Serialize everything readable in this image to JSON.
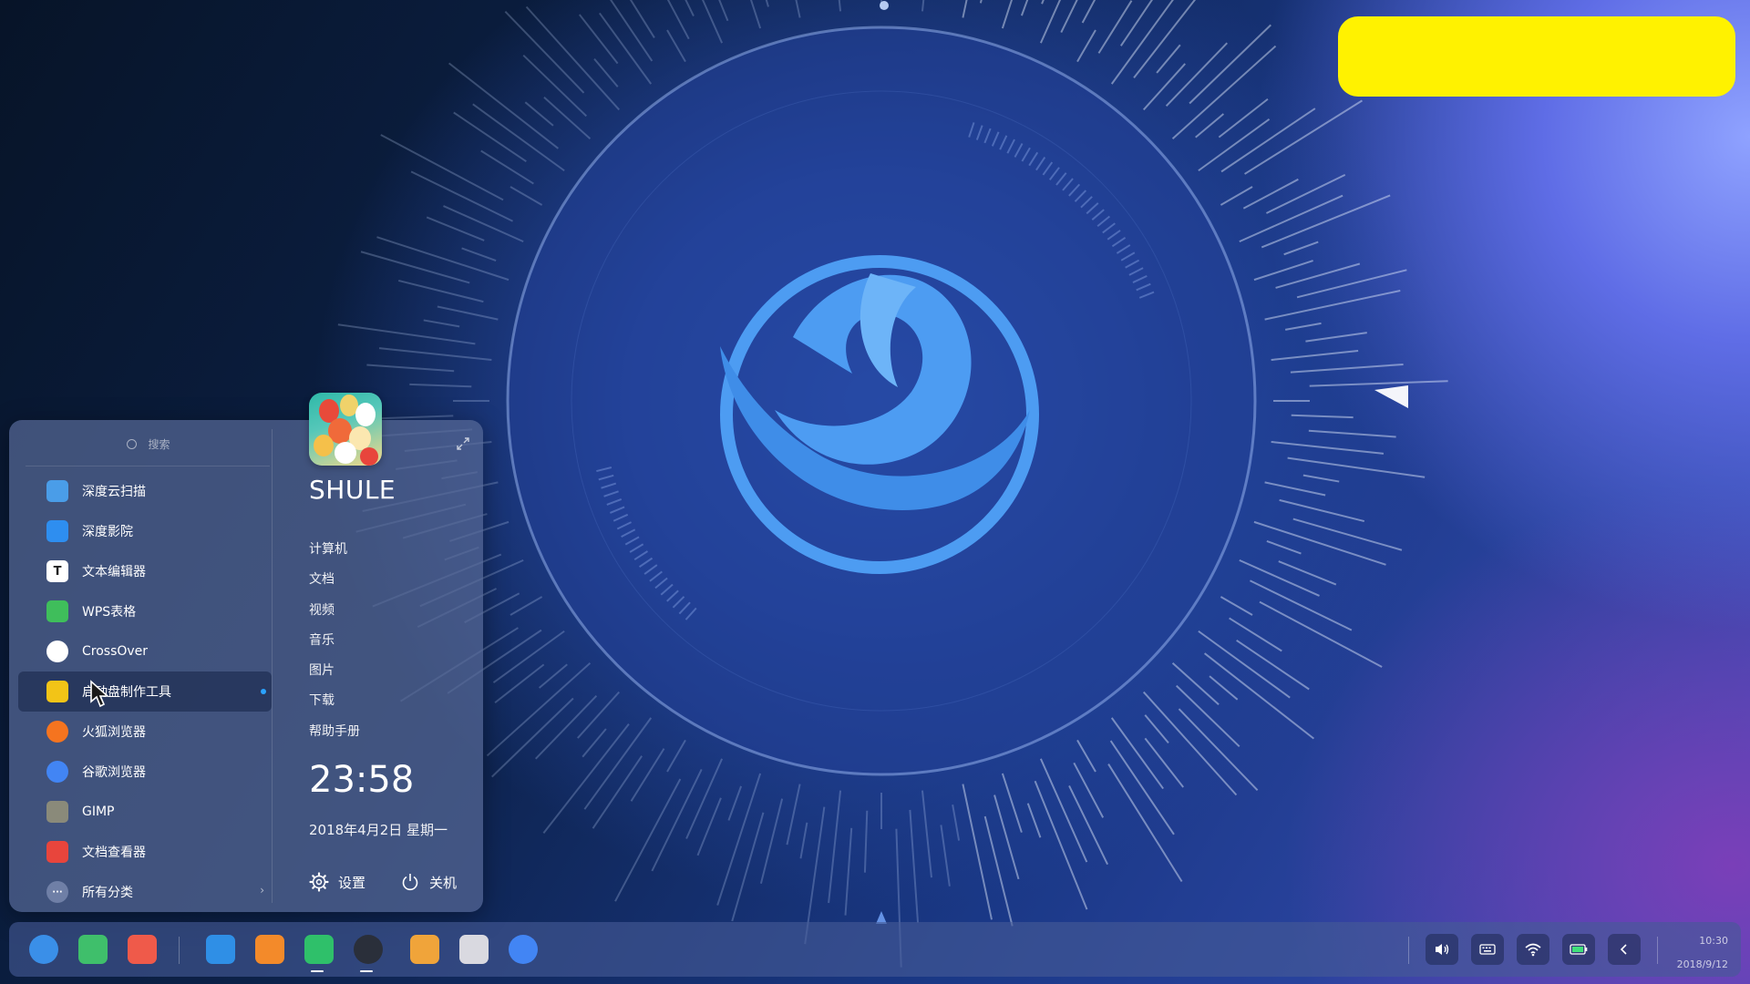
{
  "launcher": {
    "search_placeholder": "搜索",
    "apps": [
      {
        "label": "深度云扫描",
        "icon": "scanner-icon",
        "color": "#4a9de8"
      },
      {
        "label": "深度影院",
        "icon": "movie-icon",
        "color": "#2e8ef0"
      },
      {
        "label": "文本编辑器",
        "icon": "text-editor-icon",
        "color": "#ffffff"
      },
      {
        "label": "WPS表格",
        "icon": "spreadsheet-icon",
        "color": "#3fbe5b"
      },
      {
        "label": "CrossOver",
        "icon": "crossover-icon",
        "color": "#ffffff"
      },
      {
        "label": "启动盘制作工具",
        "icon": "bootmaker-icon",
        "color": "#f2c417"
      },
      {
        "label": "火狐浏览器",
        "icon": "firefox-icon",
        "color": "#f5741f"
      },
      {
        "label": "谷歌浏览器",
        "icon": "chrome-icon",
        "color": "#4285f4"
      },
      {
        "label": "GIMP",
        "icon": "gimp-icon",
        "color": "#8a8a7a"
      },
      {
        "label": "文档查看器",
        "icon": "document-viewer-icon",
        "color": "#e8453c"
      },
      {
        "label": "所有分类",
        "icon": "more-icon",
        "color": "#6f7fa6"
      }
    ],
    "user_name": "SHULE",
    "places": [
      "计算机",
      "文档",
      "视频",
      "音乐",
      "图片",
      "下载",
      "帮助手册"
    ],
    "time": "23:58",
    "date": "2018年4月2日 星期一",
    "settings_label": "设置",
    "shutdown_label": "关机"
  },
  "dock": {
    "apps": [
      {
        "name": "launcher-icon",
        "color": "#3a8fe8"
      },
      {
        "name": "file-manager-icon",
        "color": "#3fbf6b"
      },
      {
        "name": "screen-recorder-icon",
        "color": "#ef5a4a"
      },
      {
        "name": "app-store-icon",
        "color": "#2f8fe6"
      },
      {
        "name": "archive-manager-icon",
        "color": "#f38a2a"
      },
      {
        "name": "music-icon",
        "color": "#2fc06a"
      },
      {
        "name": "movie-icon",
        "color": "#2a2f3a"
      },
      {
        "name": "image-viewer-icon",
        "color": "#f0a43a"
      },
      {
        "name": "camera-icon",
        "color": "#d9d9e0"
      },
      {
        "name": "chrome-icon",
        "color": "#4285f4"
      }
    ],
    "tray": [
      "volume-icon",
      "keyboard-icon",
      "wifi-icon",
      "battery-icon",
      "chevron-left-icon"
    ],
    "clock_time": "10:30",
    "clock_date": "2018/9/12"
  },
  "colors": {
    "accent": "#2ba3ff",
    "redaction": "#fff200"
  }
}
